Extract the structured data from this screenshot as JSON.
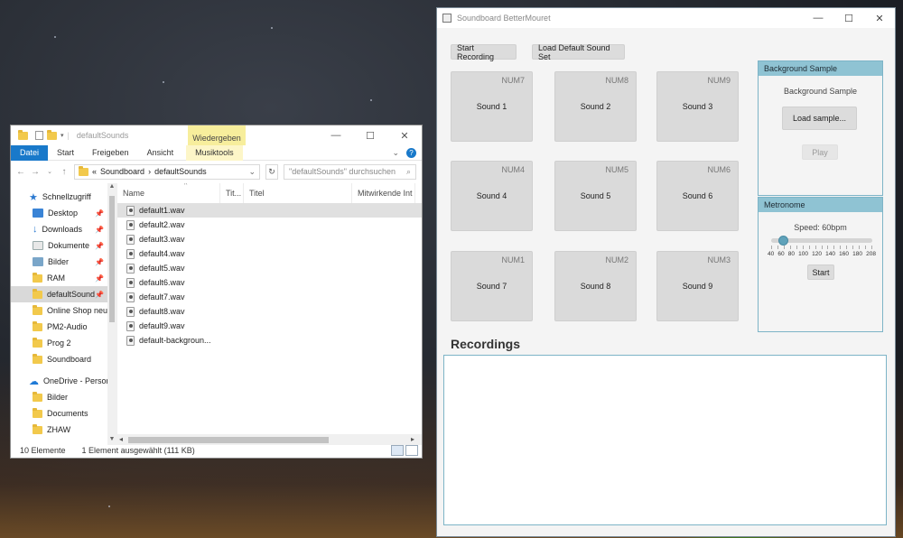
{
  "explorer": {
    "title": "defaultSounds",
    "context_tab": "Wiedergeben",
    "ribbon_tabs": [
      "Datei",
      "Start",
      "Freigeben",
      "Ansicht",
      "Musiktools"
    ],
    "address": {
      "prefix": "«",
      "crumbs": [
        "Soundboard",
        "defaultSounds"
      ],
      "separator": "›"
    },
    "search_placeholder": "\"defaultSounds\" durchsuchen",
    "columns": [
      "Name",
      "Tit...",
      "Titel",
      "Mitwirkende Int"
    ],
    "nav": {
      "quick_access": "Schnellzugriff",
      "items": [
        {
          "label": "Desktop",
          "icon": "desktop-icon",
          "pinned": true
        },
        {
          "label": "Downloads",
          "icon": "download-icon",
          "pinned": true
        },
        {
          "label": "Dokumente",
          "icon": "document-icon",
          "pinned": true
        },
        {
          "label": "Bilder",
          "icon": "pictures-icon",
          "pinned": true
        },
        {
          "label": "RAM",
          "icon": "folder-icon",
          "pinned": true
        },
        {
          "label": "defaultSound",
          "icon": "folder-icon",
          "pinned": true
        },
        {
          "label": "Online Shop neu",
          "icon": "folder-icon",
          "pinned": false
        },
        {
          "label": "PM2-Audio",
          "icon": "folder-icon",
          "pinned": false
        },
        {
          "label": "Prog 2",
          "icon": "folder-icon",
          "pinned": false
        },
        {
          "label": "Soundboard",
          "icon": "folder-icon",
          "pinned": false
        }
      ],
      "onedrive": "OneDrive - Persor",
      "onedrive_items": [
        "Bilder",
        "Documents",
        "ZHAW"
      ]
    },
    "files": [
      "default1.wav",
      "default2.wav",
      "default3.wav",
      "default4.wav",
      "default5.wav",
      "default6.wav",
      "default7.wav",
      "default8.wav",
      "default9.wav",
      "default-backgroun..."
    ],
    "status_count": "10 Elemente",
    "status_selection": "1 Element ausgewählt (111 KB)"
  },
  "soundboard": {
    "title": "Soundboard BetterMouret",
    "start_recording": "Start Recording",
    "load_default": "Load Default Sound Set",
    "pads": [
      {
        "key": "NUM7",
        "label": "Sound 1"
      },
      {
        "key": "NUM8",
        "label": "Sound 2"
      },
      {
        "key": "NUM9",
        "label": "Sound 3"
      },
      {
        "key": "NUM4",
        "label": "Sound 4"
      },
      {
        "key": "NUM5",
        "label": "Sound 5"
      },
      {
        "key": "NUM6",
        "label": "Sound 6"
      },
      {
        "key": "NUM1",
        "label": "Sound 7"
      },
      {
        "key": "NUM2",
        "label": "Sound 8"
      },
      {
        "key": "NUM3",
        "label": "Sound 9"
      }
    ],
    "background": {
      "header": "Background Sample",
      "label": "Background Sample",
      "load_button": "Load sample...",
      "play_button": "Play"
    },
    "metronome": {
      "header": "Metronome",
      "speed_label": "Speed: 60bpm",
      "speed_value": 60,
      "range": [
        40,
        208
      ],
      "ticks": [
        "40",
        "60",
        "80",
        "100",
        "120",
        "140",
        "160",
        "180",
        "208"
      ],
      "start_button": "Start"
    },
    "recordings_title": "Recordings"
  },
  "colors": {
    "accent_header": "#8fc3d3",
    "explorer_file_tab": "#1979ca",
    "context_tab": "#f7ee9c"
  }
}
